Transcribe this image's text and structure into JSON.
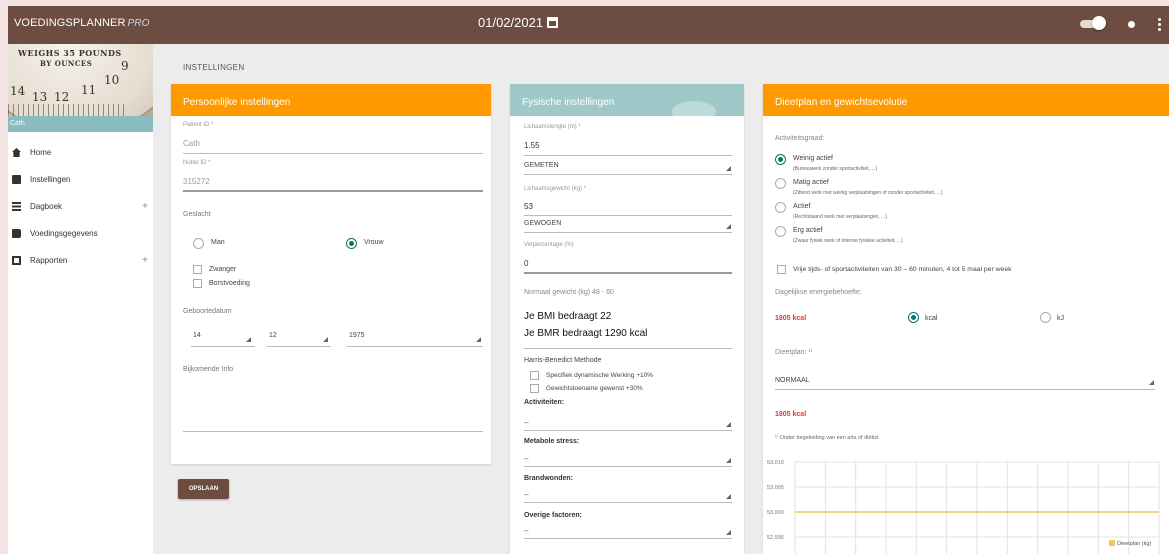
{
  "app": {
    "name": "VOEDINGSPLANNER",
    "edition": "PRO",
    "date": "01/02/2021"
  },
  "sidebar": {
    "hero_text1": "WEIGHS 35 POUNDS",
    "hero_text2": "BY OUNCES",
    "hero_numbers": [
      "14",
      "13",
      "12",
      "11",
      "10",
      "9"
    ],
    "user": "Cath",
    "items": [
      {
        "label": "Home",
        "icon": "home-icon",
        "expandable": false
      },
      {
        "label": "Instellingen",
        "icon": "settings-icon",
        "expandable": false
      },
      {
        "label": "Dagboek",
        "icon": "list-icon",
        "expandable": true
      },
      {
        "label": "Voedingsgegevens",
        "icon": "book-icon",
        "expandable": false
      },
      {
        "label": "Rapporten",
        "icon": "report-icon",
        "expandable": true
      }
    ],
    "plus": "+"
  },
  "page_title": "INSTELLINGEN",
  "persoonlijk": {
    "title": "Persoonlijke instellingen",
    "patient_label": "Patient ID *",
    "patient_value": "Cath",
    "nubel_label": "Nubel ID *",
    "nubel_value": "315272",
    "geslacht_label": "Geslacht",
    "man": "Man",
    "vrouw": "Vrouw",
    "selected_gender": "Vrouw",
    "zwanger": "Zwanger",
    "borstvoeding": "Borstvoeding",
    "geboorte_label": "Geboortedatum",
    "day": "14",
    "month": "12",
    "year": "1975",
    "info_label": "Bijkomende Info"
  },
  "save_label": "OPSLAAN",
  "fysisch": {
    "title": "Fysische instellingen",
    "lengte_label": "Lichaamslengte (m) *",
    "lengte_value": "1.55",
    "lengte_method": "GEMETEN",
    "gewicht_label": "Lichaamsgewicht (kg) *",
    "gewicht_value": "53",
    "gewicht_method": "GEWOGEN",
    "vetpct_label": "Vetpercentage (%)",
    "vetpct_value": "0",
    "normaal": "Normaal gewicht (kg) 48 - 60",
    "bmi": "Je BMI bedraagt 22",
    "bmr": "Je BMR bedraagt 1290 kcal",
    "methode": "Harris-Benedict Methode",
    "spec": "Specifiek dynamische Werking +10%",
    "toename": "Gewichtstoename gewenst +30%",
    "activiteiten_label": "Activiteiten:",
    "metabole_label": "Metabole stress:",
    "brand_label": "Brandwonden:",
    "overige_label": "Overige factoren:",
    "dash": "--"
  },
  "dieet": {
    "title": "Dieetplan en gewichtsevolutie",
    "activiteit_label": "Activiteitsgraad:",
    "options": [
      {
        "label": "Weinig actief",
        "desc": "(Bureauwerk zonder sportactiviteit, ...)"
      },
      {
        "label": "Matig actief",
        "desc": "(Zittend werk met weinig verplaatsingen of zonder sportactiviteit, ...)"
      },
      {
        "label": "Actief",
        "desc": "(Rechtstaand werk met verplaatsingen, ...)"
      },
      {
        "label": "Erg actief",
        "desc": "(Zwaar fysiek werk of intense fysieke activiteit, ...)"
      }
    ],
    "selected_option": "Weinig actief",
    "vrije": "Vrije tijds- of sportactiviteiten van 30 – 60 minuten, 4 tot 5 maal per week",
    "energie_label": "Dagelijkse energiebehoefte:",
    "energie_value": "1805 kcal",
    "kcal": "kcal",
    "kj": "kJ",
    "selected_unit": "kcal",
    "dieetplan_label": "Dieetplan: ¹⁾",
    "dieetplan_value": "NORMAAL",
    "dieetplan_kcal": "1805 kcal",
    "footnote": "¹⁾ Onder begeleiding van een arts of diëtist"
  },
  "chart_data": {
    "type": "line",
    "y_ticks": [
      "53.010",
      "53.005",
      "53.000",
      "52.995",
      "52.990"
    ],
    "ylim": [
      52.99,
      53.01
    ],
    "series": [
      {
        "name": "Dieetplan (kg)",
        "values": [
          53.0,
          53.0,
          53.0,
          53.0,
          53.0,
          53.0,
          53.0,
          53.0,
          53.0,
          53.0,
          53.0,
          53.0,
          53.0
        ]
      }
    ],
    "grid": true,
    "legend": "bottom-right",
    "colors": {
      "series": "#f0c85a"
    }
  },
  "colors": {
    "brown": "#6d4c41",
    "orange": "#ff9900",
    "teal": "#9fc8c8",
    "red": "#e53935",
    "green": "#00796b"
  }
}
